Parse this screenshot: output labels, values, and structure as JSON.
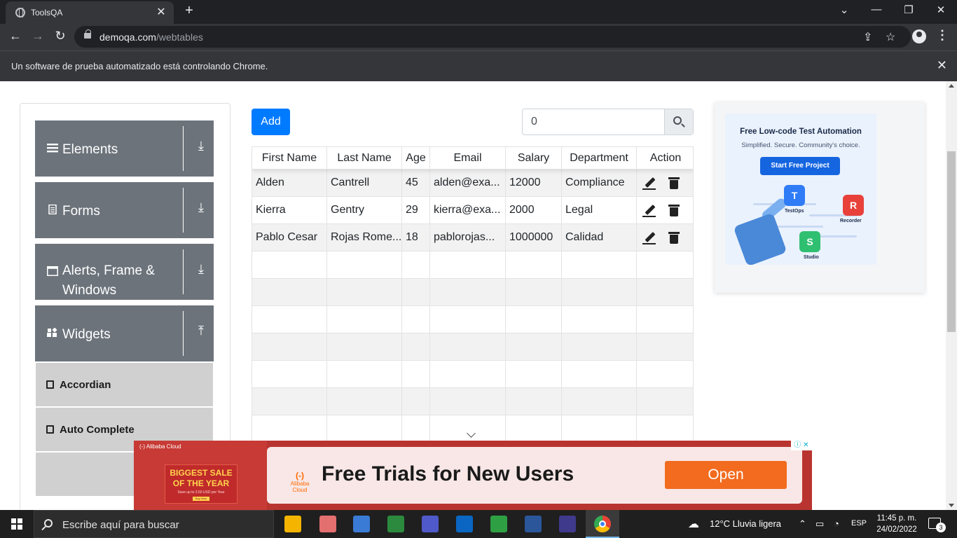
{
  "browser": {
    "tab_title": "ToolsQA",
    "tab_close": "✕",
    "new_tab": "+",
    "window_controls": {
      "minimize": "—",
      "restore": "❐",
      "close": "✕",
      "tab_search": "⌄"
    },
    "url_host": "demoqa.com",
    "url_path": "/webtables",
    "automation_message": "Un software de prueba automatizado está controlando Chrome.",
    "automation_close": "✕"
  },
  "sidebar": {
    "groups": [
      {
        "label": "Elements",
        "icon": "hamburger-icon",
        "arrow": "⤓"
      },
      {
        "label": "Forms",
        "icon": "document-icon",
        "arrow": "⤓"
      },
      {
        "label": "Alerts, Frame & Windows",
        "icon": "window-icon",
        "arrow": "⤓"
      },
      {
        "label": "Widgets",
        "icon": "widgets-icon",
        "arrow": "⤒"
      }
    ],
    "subitems": [
      {
        "label": "Accordian"
      },
      {
        "label": "Auto Complete"
      }
    ]
  },
  "toolbar": {
    "add_label": "Add",
    "search_value": "0"
  },
  "table": {
    "columns": [
      "First Name",
      "Last Name",
      "Age",
      "Email",
      "Salary",
      "Department",
      "Action"
    ],
    "rows": [
      {
        "first": "Alden",
        "last": "Cantrell",
        "age": "45",
        "email": "alden@exa...",
        "salary": "12000",
        "department": "Compliance"
      },
      {
        "first": "Kierra",
        "last": "Gentry",
        "age": "29",
        "email": "kierra@exa...",
        "salary": "2000",
        "department": "Legal"
      },
      {
        "first": "Pablo Cesar",
        "last": "Rojas Rome...",
        "age": "18",
        "email": "pablorojas...",
        "salary": "1000000",
        "department": "Calidad"
      }
    ]
  },
  "side_ad": {
    "headline": "Free Low-code Test Automation",
    "subline": "Simplified. Secure. Community's choice.",
    "button": "Start Free Project",
    "tiles": [
      {
        "letter": "T",
        "label": "TestOps",
        "color": "#2f7cf6"
      },
      {
        "letter": "R",
        "label": "Recorder",
        "color": "#e8413a"
      },
      {
        "letter": "S",
        "label": "Studio",
        "color": "#2fbf71"
      }
    ]
  },
  "banner_ad": {
    "brand": "(-) Alibaba Cloud",
    "sale_line1": "BIGGEST SALE",
    "sale_line2": "OF THE YEAR",
    "sale_small": "Save up to 3.50 USD per Year",
    "sale_button": "Buy Now",
    "logo_mark": "(-)",
    "logo_text": "Alibaba Cloud",
    "headline": "Free Trials for New Users",
    "cta": "Open",
    "adchoices": "ⓘ ✕"
  },
  "taskbar": {
    "search_placeholder": "Escribe aquí para buscar",
    "weather": "12°C  Lluvia ligera",
    "tray_arrow": "⌃",
    "language": "ESP",
    "time": "11:45 p. m.",
    "date": "24/02/2022",
    "notifications": "3",
    "apps": [
      {
        "name": "file-explorer-icon",
        "color": "#f4b400"
      },
      {
        "name": "paint-icon",
        "color": "#e46f6f"
      },
      {
        "name": "network-icon",
        "color": "#3a7bd5"
      },
      {
        "name": "media-player-icon",
        "color": "#2b8a3e"
      },
      {
        "name": "teams-icon",
        "color": "#5059c9"
      },
      {
        "name": "outlook-icon",
        "color": "#0a66c2"
      },
      {
        "name": "tool-icon",
        "color": "#2ea043"
      },
      {
        "name": "word-icon",
        "color": "#2b579a"
      },
      {
        "name": "eclipse-icon",
        "color": "#3f3a8c"
      },
      {
        "name": "chrome-icon",
        "color": "#34a853"
      }
    ]
  }
}
